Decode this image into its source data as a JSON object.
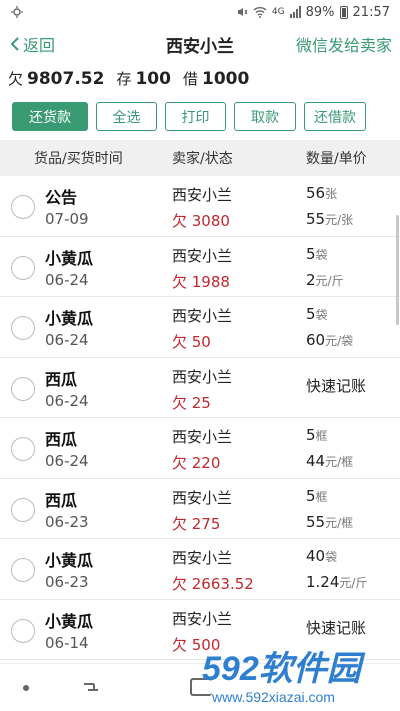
{
  "status": {
    "battery": "89%",
    "time": "21:57",
    "network": "4G"
  },
  "header": {
    "back_label": "返回",
    "title": "西安小兰",
    "wechat_label": "微信发给卖家"
  },
  "summary": {
    "owe_label": "欠",
    "owe_value": "9807.52",
    "stock_label": "存",
    "stock_value": "100",
    "borrow_label": "借",
    "borrow_value": "1000"
  },
  "actions": {
    "repay": "还货款",
    "select_all": "全选",
    "print": "打印",
    "withdraw": "取款",
    "repay_loan": "还借款"
  },
  "columns": {
    "goods": "货品/买货时间",
    "seller": "卖家/状态",
    "qty": "数量/单价"
  },
  "rows": [
    {
      "goods": "公告",
      "date": "07-09",
      "seller": "西安小兰",
      "owe": "欠 3080",
      "qty": "56",
      "qty_unit": "张",
      "price": "55",
      "price_unit": "元/张"
    },
    {
      "goods": "小黄瓜",
      "date": "06-24",
      "seller": "西安小兰",
      "owe": "欠 1988",
      "qty": "5",
      "qty_unit": "袋",
      "price": "2",
      "price_unit": "元/斤"
    },
    {
      "goods": "小黄瓜",
      "date": "06-24",
      "seller": "西安小兰",
      "owe": "欠 50",
      "qty": "5",
      "qty_unit": "袋",
      "price": "60",
      "price_unit": "元/袋"
    },
    {
      "goods": "西瓜",
      "date": "06-24",
      "seller": "西安小兰",
      "owe": "欠 25",
      "quick": "快速记账"
    },
    {
      "goods": "西瓜",
      "date": "06-24",
      "seller": "西安小兰",
      "owe": "欠 220",
      "qty": "5",
      "qty_unit": "框",
      "price": "44",
      "price_unit": "元/框"
    },
    {
      "goods": "西瓜",
      "date": "06-23",
      "seller": "西安小兰",
      "owe": "欠 275",
      "qty": "5",
      "qty_unit": "框",
      "price": "55",
      "price_unit": "元/框"
    },
    {
      "goods": "小黄瓜",
      "date": "06-23",
      "seller": "西安小兰",
      "owe": "欠 2663.52",
      "qty": "40",
      "qty_unit": "袋",
      "price": "1.24",
      "price_unit": "元/斤"
    },
    {
      "goods": "小黄瓜",
      "date": "06-14",
      "seller": "西安小兰",
      "owe": "欠 500",
      "quick": "快速记账"
    }
  ],
  "watermark": {
    "brand": "592软件园",
    "url": "www.592xiazai.com"
  },
  "colors": {
    "accent": "#3a9a74",
    "debt": "#c0282d"
  }
}
